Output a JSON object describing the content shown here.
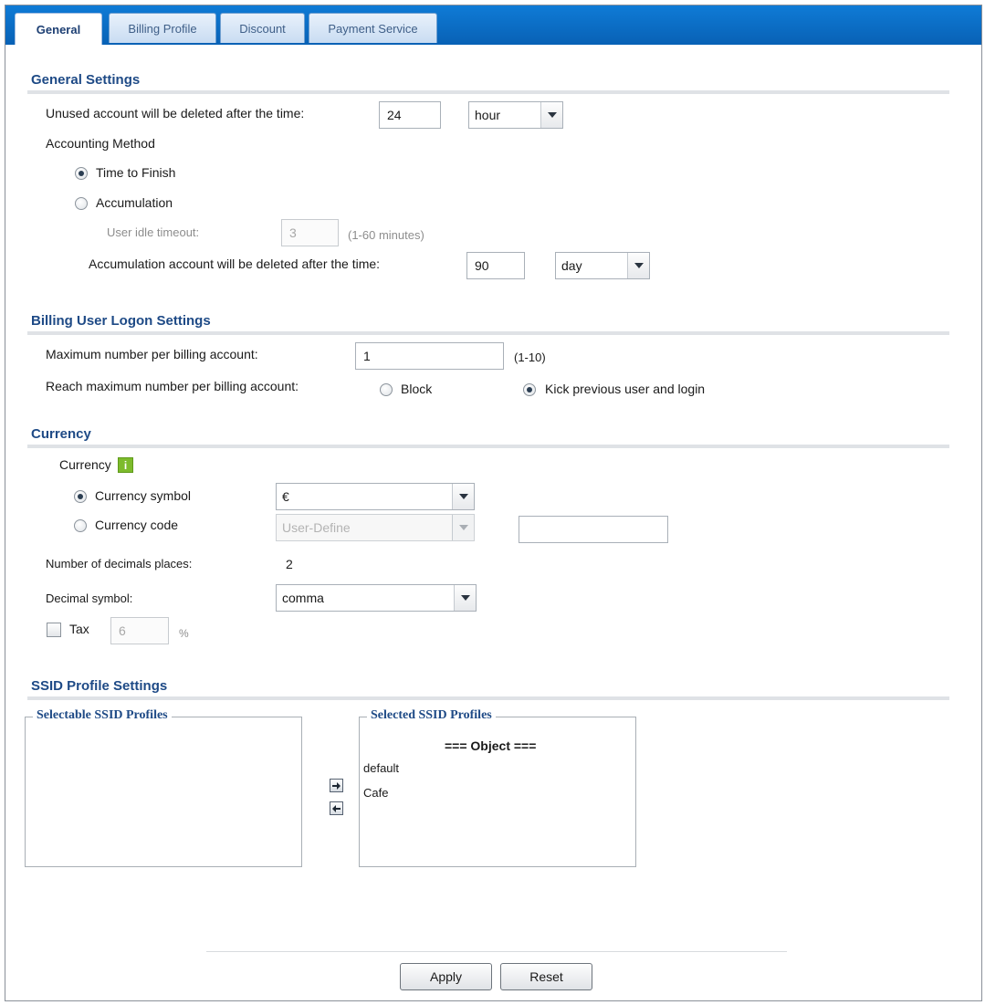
{
  "tabs": [
    {
      "label": "General",
      "active": true
    },
    {
      "label": "Billing Profile",
      "active": false
    },
    {
      "label": "Discount",
      "active": false
    },
    {
      "label": "Payment Service",
      "active": false
    }
  ],
  "general": {
    "title": "General Settings",
    "unused_label": "Unused account will be deleted after the time:",
    "unused_value": "24",
    "unused_unit": "hour",
    "accounting_label": "Accounting Method",
    "time_to_finish_label": "Time to Finish",
    "time_to_finish_selected": true,
    "accumulation_label": "Accumulation",
    "accumulation_selected": false,
    "idle_label": "User idle timeout:",
    "idle_value": "3",
    "idle_hint": "(1-60 minutes)",
    "acc_deleted_label": "Accumulation account will be deleted after the time:",
    "acc_deleted_value": "90",
    "acc_deleted_unit": "day"
  },
  "logon": {
    "title": "Billing User Logon Settings",
    "max_label": "Maximum number per billing account:",
    "max_value": "1",
    "max_hint": "(1-10)",
    "reach_label": "Reach maximum number per billing account:",
    "block_label": "Block",
    "block_selected": false,
    "kick_label": "Kick previous user and login",
    "kick_selected": true
  },
  "currency": {
    "title": "Currency",
    "label": "Currency",
    "info_icon": "info-icon",
    "symbol_label": "Currency symbol",
    "symbol_selected": true,
    "symbol_value": "€",
    "code_label": "Currency code",
    "code_selected": false,
    "code_value": "User-Define",
    "code_custom_value": "",
    "decimals_label": "Number of decimals places:",
    "decimals_value": "2",
    "decimal_symbol_label": "Decimal symbol:",
    "decimal_symbol_value": "comma",
    "tax_label": "Tax",
    "tax_checked": false,
    "tax_value": "6",
    "tax_unit": "%"
  },
  "ssid": {
    "title": "SSID Profile Settings",
    "selectable_legend": "Selectable SSID Profiles",
    "selected_legend": "Selected SSID Profiles",
    "selected_header": "=== Object ===",
    "selected_items": [
      "default",
      "Cafe"
    ],
    "move_right_icon": "arrow-right-icon",
    "move_left_icon": "arrow-left-icon"
  },
  "footer": {
    "apply_label": "Apply",
    "reset_label": "Reset"
  }
}
